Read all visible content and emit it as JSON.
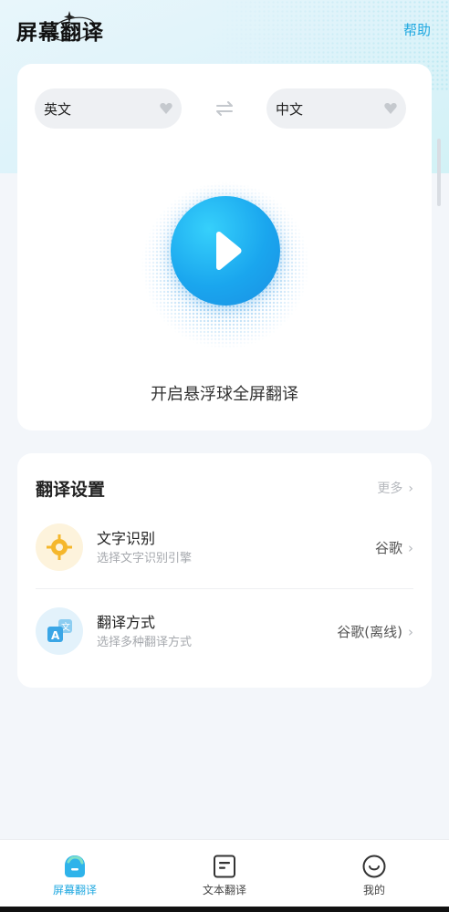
{
  "header": {
    "title": "屏幕翻译",
    "help": "帮助"
  },
  "translator": {
    "source_lang": "英文",
    "target_lang": "中文",
    "caption": "开启悬浮球全屏翻译"
  },
  "settings": {
    "title": "翻译设置",
    "more": "更多",
    "rows": [
      {
        "title": "文字识别",
        "subtitle": "选择文字识别引擎",
        "value": "谷歌"
      },
      {
        "title": "翻译方式",
        "subtitle": "选择多种翻译方式",
        "value": "谷歌(离线)"
      }
    ]
  },
  "nav": {
    "items": [
      {
        "label": "屏幕翻译",
        "active": true
      },
      {
        "label": "文本翻译",
        "active": false
      },
      {
        "label": "我的",
        "active": false
      }
    ]
  },
  "colors": {
    "accent": "#1fa8e0",
    "play_button": "#1aa6ee",
    "ocr_icon": "#f5b72c",
    "mode_icon": "#3aa6e6"
  },
  "icons": {
    "play": "play-icon",
    "swap": "swap-icon",
    "ocr": "crosshair-icon",
    "mode": "translate-icon",
    "nav_home": "home-icon",
    "nav_text": "document-icon",
    "nav_me": "smile-icon"
  }
}
